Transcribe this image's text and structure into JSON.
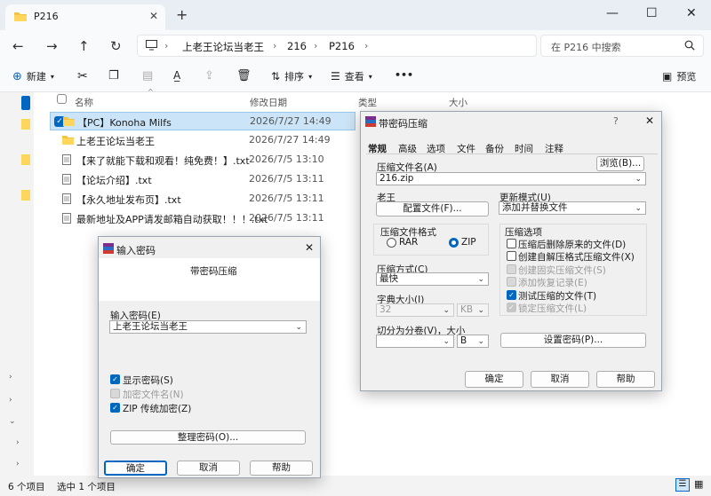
{
  "explorer": {
    "tab_title": "P216",
    "breadcrumb": [
      "上老王论坛当老王",
      "216",
      "P216"
    ],
    "search_placeholder": "在 P216 中搜索",
    "toolbar": {
      "new": "新建",
      "sort": "排序",
      "view": "查看",
      "more": "•••",
      "preview": "预览"
    },
    "columns": {
      "name": "名称",
      "date": "修改日期",
      "type": "类型",
      "size": "大小"
    },
    "files": [
      {
        "name": "【PC】Konoha Milfs",
        "date": "2026/7/27 14:49",
        "kind": "folder",
        "selected": true
      },
      {
        "name": "上老王论坛当老王",
        "date": "2026/7/27 14:49",
        "kind": "folder",
        "selected": false
      },
      {
        "name": "【来了就能下载和观看！纯免费！】.txt",
        "date": "2026/7/5 13:10",
        "kind": "txt",
        "selected": false
      },
      {
        "name": "【论坛介绍】.txt",
        "date": "2026/7/5 13:11",
        "kind": "txt",
        "selected": false
      },
      {
        "name": "【永久地址发布页】.txt",
        "date": "2026/7/5 13:11",
        "kind": "txt",
        "selected": false
      },
      {
        "name": "最新地址及APP请发邮箱自动获取！！！.txt",
        "date": "2026/7/5 13:11",
        "kind": "txt",
        "selected": false
      }
    ],
    "status": {
      "count": "6 个项目",
      "selected": "选中 1 个项目"
    }
  },
  "archive_dialog": {
    "title": "带密码压缩",
    "help_glyph": "?",
    "tabs": [
      "常规",
      "高级",
      "选项",
      "文件",
      "备份",
      "时间",
      "注释"
    ],
    "archive_name_label": "压缩文件名(A)",
    "archive_name": "216.zip",
    "browse": "浏览(B)...",
    "profile_label": "老王",
    "profile_button": "配置文件(F)...",
    "update_mode_label": "更新模式(U)",
    "update_mode": "添加并替换文件",
    "format_label": "压缩文件格式",
    "format_rar": "RAR",
    "format_zip": "ZIP",
    "method_label": "压缩方式(C)",
    "method": "最快",
    "dict_label": "字典大小(I)",
    "dict_size": "32",
    "dict_unit": "KB",
    "split_label": "切分为分卷(V)，大小",
    "split_unit": "B",
    "options_label": "压缩选项",
    "options": [
      {
        "label": "压缩后删除原来的文件(D)",
        "checked": false,
        "disabled": false
      },
      {
        "label": "创建自解压格式压缩文件(X)",
        "checked": false,
        "disabled": false
      },
      {
        "label": "创建固实压缩文件(S)",
        "checked": false,
        "disabled": true
      },
      {
        "label": "添加恢复记录(E)",
        "checked": false,
        "disabled": true
      },
      {
        "label": "测试压缩的文件(T)",
        "checked": true,
        "disabled": false
      },
      {
        "label": "锁定压缩文件(L)",
        "checked": true,
        "disabled": true
      }
    ],
    "set_password": "设置密码(P)...",
    "ok": "确定",
    "cancel": "取消",
    "help": "帮助"
  },
  "password_dialog": {
    "title": "输入密码",
    "heading": "带密码压缩",
    "password_label": "输入密码(E)",
    "password_value": "上老王论坛当老王",
    "show_password": "显示密码(S)",
    "encrypt_names": "加密文件名(N)",
    "zip_legacy": "ZIP 传统加密(Z)",
    "organize": "整理密码(O)...",
    "ok": "确定",
    "cancel": "取消",
    "help": "帮助"
  }
}
